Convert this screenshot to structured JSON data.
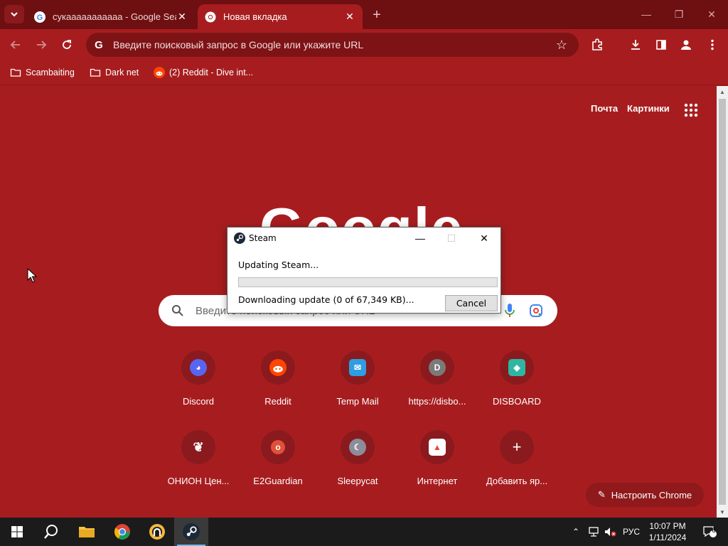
{
  "browser": {
    "tabs": [
      {
        "title": "сукааааааааааа - Google Sea",
        "favicon": "google-g-icon",
        "active": false
      },
      {
        "title": "Новая вкладка",
        "favicon": "chrome-icon",
        "active": true
      }
    ],
    "omnibox": {
      "placeholder": "Введите поисковый запрос в Google или укажите URL"
    },
    "bookmarks": [
      {
        "label": "Scambaiting",
        "icon": "folder-icon"
      },
      {
        "label": "Dark net",
        "icon": "folder-icon"
      },
      {
        "label": "(2) Reddit - Dive int...",
        "icon": "reddit-icon"
      }
    ]
  },
  "newtab": {
    "top_links": {
      "mail": "Почта",
      "images": "Картинки"
    },
    "logo_text": "Google",
    "search_placeholder": "Введите поисковый запрос или URL",
    "shortcuts_row1": [
      {
        "label": "Discord",
        "icon": "discord-icon",
        "color": "#5865f2"
      },
      {
        "label": "Reddit",
        "icon": "reddit-icon",
        "color": "#ff4500"
      },
      {
        "label": "Temp Mail",
        "icon": "temp-mail-icon",
        "color": "#2f9de0"
      },
      {
        "label": "https://disbo...",
        "icon": "letter-d-icon",
        "color": "#7a7a7a"
      },
      {
        "label": "DISBOARD",
        "icon": "disboard-icon",
        "color": "#2fb6a3"
      }
    ],
    "shortcuts_row2": [
      {
        "label": "ОНИОН Цен...",
        "icon": "onion-icon",
        "color": "#ffffff"
      },
      {
        "label": "E2Guardian",
        "icon": "e2guardian-icon",
        "color": "#e0503a"
      },
      {
        "label": "Sleepycat",
        "icon": "sleepycat-icon",
        "color": "#8c8c9a"
      },
      {
        "label": "Интернет",
        "icon": "internet-icon",
        "color": "#e24a3a"
      },
      {
        "label": "Добавить яр...",
        "icon": "plus-icon",
        "color": "#ffffff"
      }
    ],
    "customize_label": "Настроить Chrome"
  },
  "steam_dialog": {
    "title": "Steam",
    "status": "Updating Steam...",
    "progress_fraction": 0,
    "download_text": "Downloading update (0 of 67,349 KB)...",
    "cancel_label": "Cancel"
  },
  "taskbar": {
    "language": "РУС",
    "time": "10:07 PM",
    "date": "1/11/2024",
    "notification_count": "6"
  },
  "colors": {
    "theme_red": "#a71d1f",
    "tabstrip": "#6e0f12",
    "taskbar": "#1b1b1b"
  }
}
